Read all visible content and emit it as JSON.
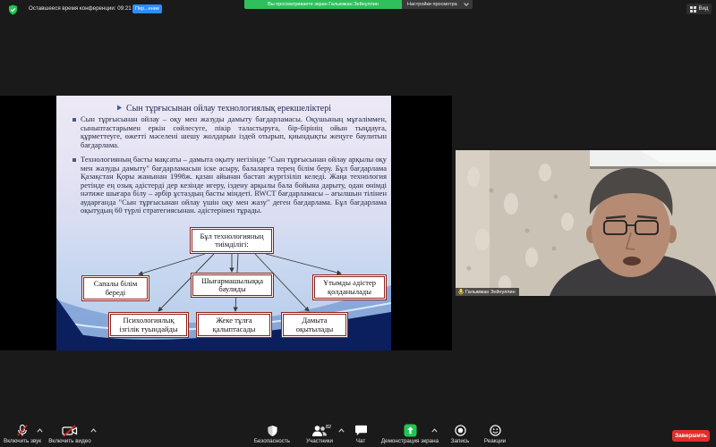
{
  "meeting": {
    "time_remaining": "Оставшееся время конференции: 09:21",
    "status_pill": "Пер...ение",
    "viewing_banner": "Вы просматриваете экран Галымжан Зейнуллин",
    "view_options": "Настройки просмотра",
    "view_button": "Вид"
  },
  "slide": {
    "title": "Сын тұрғысынан ойлау технологиялық ерекшеліктері",
    "bullets": [
      "Сын тұрғысынан ойлау – оқу мен жазуды дамыту бағдарламасы. Оқушының мұғаліммен, сыныптастарымен еркін сөйлесуге, пікір таластыруға, бір-бірінің ойын тыңдауға, құрметтеуге, өжетті мәселені шешу жолдарын іздей отырып, қиындықты жеңуге баулитын бағдарлама.",
      "Технологияның басты мақсаты – дамыта оқыту негізінде \"Сын тұрғысынан ойлау арқылы оқу мен жазуды дамыту\" бағдарламасын іске асыру, балаларға терең білім беру. Бұл бағдарлама Қазақстан Қоры жанынан 1998ж. қазан айынан бастап жүргізіліп келеді. Жаңа технология ретінде ең озық әдістерді дер кезінде игеру, іздену арқылы бала бойына дарыту, одан өнімді нәтиже шығара білу – әрбір ұстаздың басты міндеті. RWCT бағдарламасы – ағылшын тілінен аударғанда \"Сын тұрғысынан ойлау үшін оқу мен жазу\" деген бағдарлама. Бұл бағдарлама оқытудың 60 түрлі стратегиясынан. әдістерінен тұрады."
    ],
    "diagram": {
      "root": "Бұл технологияның тиімділігі:",
      "nodes": [
        "Сапалы білім береді",
        "Шығармашылыққа баулиды",
        "Ұтымды әдістер қолданылады",
        "Психологиялық ізгілік туындайды",
        "Жеке тұлға қалыптасады",
        "Дамыта оқытылады"
      ]
    }
  },
  "participant": {
    "name": "Галымжан Зейнуллин"
  },
  "toolbar": {
    "unmute": "Включить звук",
    "start_video": "Включить видео",
    "security": "Безопасность",
    "participants": "Участники",
    "participants_count": "82",
    "chat": "Чат",
    "share_screen": "Демонстрация экрана",
    "record": "Запись",
    "reactions": "Реакции",
    "end": "Завершить"
  },
  "icons": {
    "meeting_info": "shield-check-icon",
    "view": "grid-icon",
    "unmute": "microphone-muted-icon",
    "start_video": "video-off-icon",
    "security": "shield-icon",
    "participants": "participants-icon",
    "chat": "chat-icon",
    "share_screen": "share-screen-icon",
    "record": "record-icon",
    "reactions": "smiley-icon",
    "participant_audio": "audio-level-icon"
  },
  "colors": {
    "banner_green": "#2fbf5c",
    "pill_blue": "#2d8cff",
    "end_red": "#e22d2d",
    "muted_red": "#e02828",
    "share_green": "#23c552",
    "diagram_border": "#8e2219"
  }
}
